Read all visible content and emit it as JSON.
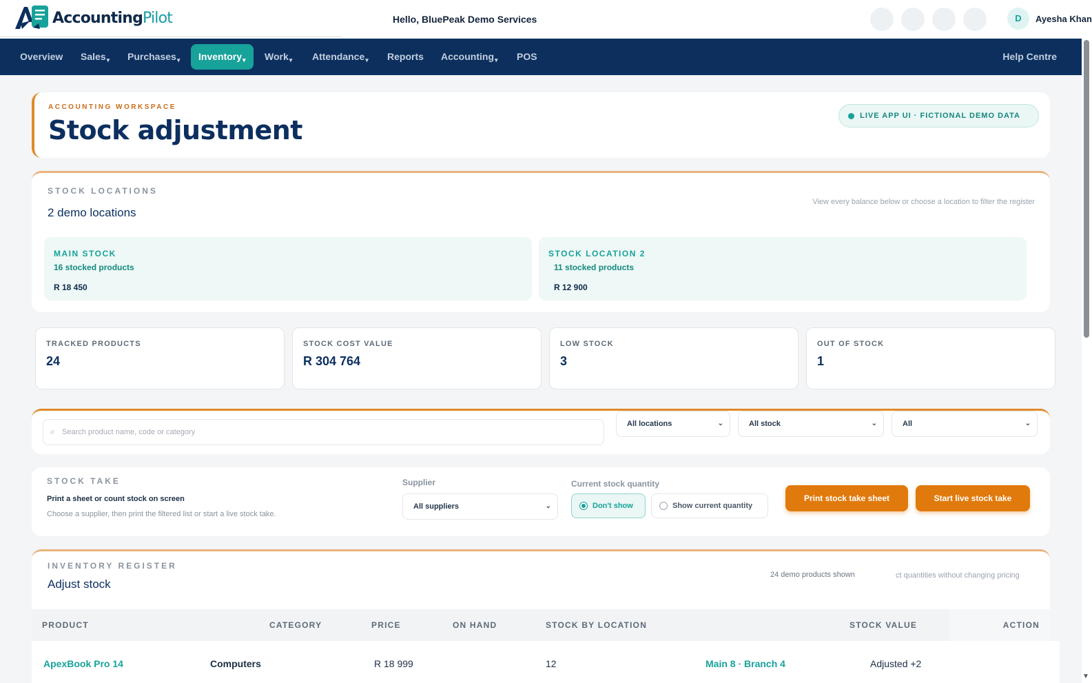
{
  "brand": {
    "name_part1": "Accounting",
    "name_part2": "Pilot"
  },
  "header": {
    "greeting": "Hello, BluePeak Demo Services",
    "avatar_initial": "D",
    "user_name": "Ayesha Khan"
  },
  "nav": {
    "items": [
      {
        "label": "Overview",
        "has_menu": false
      },
      {
        "label": "Sales",
        "has_menu": true
      },
      {
        "label": "Purchases",
        "has_menu": true
      },
      {
        "label": "Inventory",
        "has_menu": true,
        "active": true
      },
      {
        "label": "Work",
        "has_menu": true
      },
      {
        "label": "Attendance",
        "has_menu": true
      },
      {
        "label": "Reports",
        "has_menu": false
      },
      {
        "label": "Accounting",
        "has_menu": true
      },
      {
        "label": "POS",
        "has_menu": false
      }
    ],
    "help": "Help Centre"
  },
  "page": {
    "kicker": "ACCOUNTING WORKSPACE",
    "title": "Stock adjustment",
    "badge": "LIVE APP UI · FICTIONAL DEMO DATA"
  },
  "locations": {
    "section_label": "STOCK LOCATIONS",
    "subtitle": "2 demo locations",
    "hint": "View every balance below or choose a location to filter the register",
    "items": [
      {
        "name": "MAIN STOCK",
        "count": "16 stocked products",
        "value": "R 18 450"
      },
      {
        "name": "STOCK LOCATION 2",
        "count": "11 stocked products",
        "value": "R 12 900"
      }
    ]
  },
  "stats": [
    {
      "label": "TRACKED PRODUCTS",
      "value": "24"
    },
    {
      "label": "STOCK COST VALUE",
      "value": "R 304 764"
    },
    {
      "label": "LOW STOCK",
      "value": "3"
    },
    {
      "label": "OUT OF STOCK",
      "value": "1"
    }
  ],
  "filters": {
    "search_placeholder": "Search product name, code or category",
    "location_select": "All locations",
    "stock_select": "All stock",
    "category_select": "All"
  },
  "stock_take": {
    "section_label": "STOCK TAKE",
    "title": "Print a sheet or count stock on screen",
    "description": "Choose a supplier, then print the filtered list or start a live stock take.",
    "supplier_label": "Supplier",
    "supplier_value": "All suppliers",
    "quantity_label": "Current stock quantity",
    "option_hide": "Don't show",
    "option_show": "Show current quantity",
    "print_button": "Print stock take sheet",
    "start_button": "Start live stock take"
  },
  "register": {
    "section_label": "INVENTORY REGISTER",
    "subtitle": "Adjust stock",
    "count": "24 demo products shown",
    "hint": "ct quantities without changing pricing",
    "columns": [
      "PRODUCT",
      "CATEGORY",
      "PRICE",
      "ON HAND",
      "STOCK BY LOCATION",
      "STOCK VALUE",
      "ACTION"
    ],
    "rows": [
      {
        "product": "ApexBook Pro 14",
        "category": "Computers",
        "price": "R 18 999",
        "on_hand": "12",
        "by_location": "Main 8 · Branch 4",
        "stock_value": "Adjusted +2"
      }
    ]
  }
}
